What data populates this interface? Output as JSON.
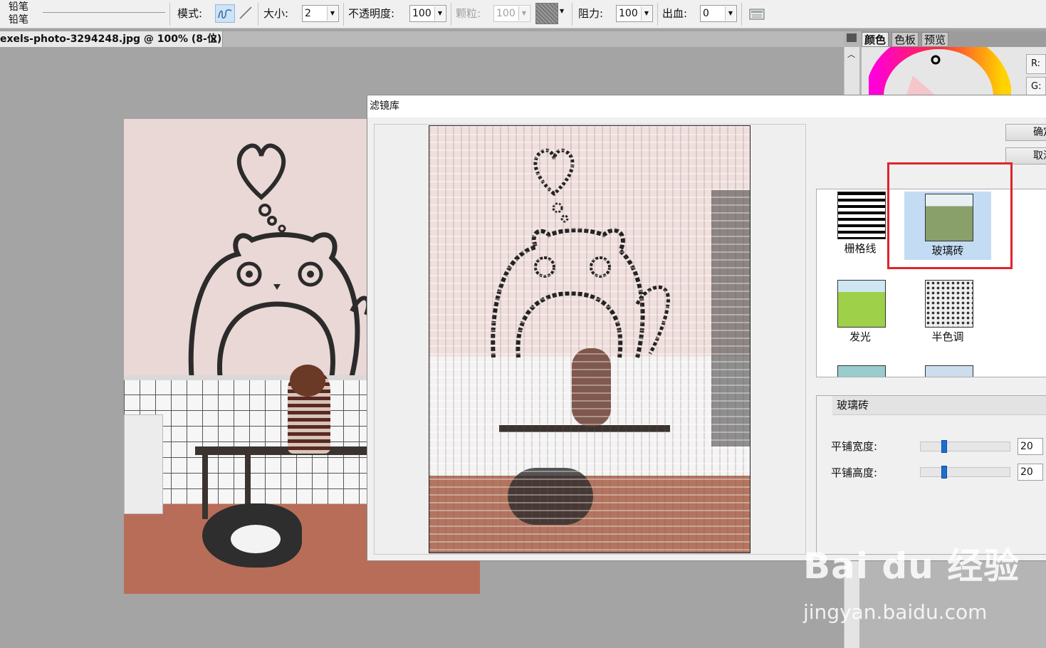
{
  "toolbar": {
    "tool_name_top": "铅笔",
    "tool_name_bottom": "铅笔",
    "mode_label": "模式:",
    "size_label": "大小:",
    "size_value": "2",
    "opacity_label": "不透明度:",
    "opacity_value": "100",
    "grain_label": "颗粒:",
    "grain_value": "100",
    "resistance_label": "阻力:",
    "resistance_value": "100",
    "bleed_label": "出血:",
    "bleed_value": "0"
  },
  "document": {
    "tab_title": "exels-photo-3294248.jpg @ 100% (8-位)",
    "close_glyph": "×"
  },
  "right_panel": {
    "tabs": [
      "颜色",
      "色板",
      "预览"
    ],
    "active_tab": "颜色",
    "r_label": "R:",
    "g_label": "G:"
  },
  "dialog": {
    "title": "滤镜库",
    "ok_label": "确定",
    "cancel_label": "取消",
    "filters": [
      {
        "name": "栅格线",
        "selected": false
      },
      {
        "name": "玻璃砖",
        "selected": true
      },
      {
        "name": "发光",
        "selected": false
      },
      {
        "name": "半色调",
        "selected": false
      }
    ],
    "params_title": "玻璃砖",
    "params": [
      {
        "label": "平铺宽度:",
        "value": "20",
        "fraction": 0.25
      },
      {
        "label": "平铺高度:",
        "value": "20",
        "fraction": 0.25
      }
    ]
  },
  "watermark": {
    "brand": "Bai du 经验",
    "url": "jingyan.baidu.com"
  },
  "colors": {
    "highlight": "#e0242c",
    "slider": "#1c6fd1",
    "selected_thumb": "#c3dcf3"
  }
}
